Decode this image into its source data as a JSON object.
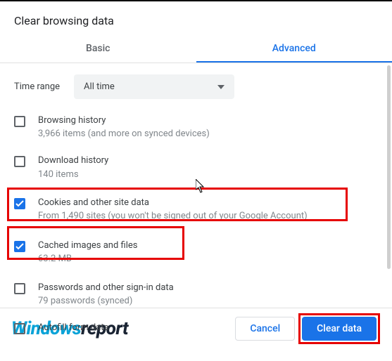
{
  "title": "Clear browsing data",
  "tabs": {
    "basic": "Basic",
    "advanced": "Advanced"
  },
  "time": {
    "label": "Time range",
    "value": "All time"
  },
  "items": [
    {
      "title": "Browsing history",
      "sub": "3,966 items (and more on synced devices)",
      "checked": false
    },
    {
      "title": "Download history",
      "sub": "140 items",
      "checked": false
    },
    {
      "title": "Cookies and other site data",
      "sub": "From 1,490 sites (you won't be signed out of your Google Account)",
      "checked": true
    },
    {
      "title": "Cached images and files",
      "sub": "63.2 MB",
      "checked": true
    },
    {
      "title": "Passwords and other sign-in data",
      "sub": "79 passwords (synced)",
      "checked": false
    },
    {
      "title": "Autofill form data",
      "sub": "",
      "checked": false
    }
  ],
  "footer": {
    "cancel": "Cancel",
    "clear": "Clear data"
  },
  "logo": {
    "part1": "Windows",
    "part2": "report"
  }
}
